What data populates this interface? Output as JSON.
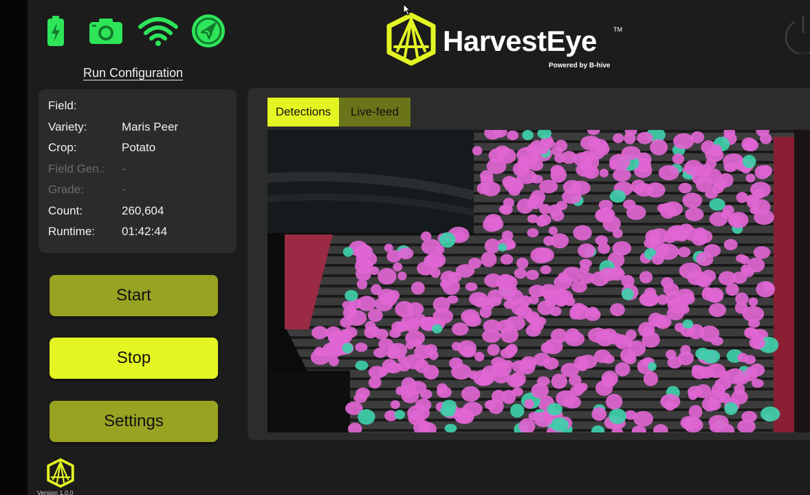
{
  "status_icons": [
    "battery-icon",
    "camera-icon",
    "wifi-icon",
    "navigation-icon"
  ],
  "run_config_link": "Run Configuration",
  "brand": {
    "name": "HarvestEye",
    "tm": "TM",
    "powered_by": "Powered by B-hive",
    "accent": "#e3f522"
  },
  "config": {
    "field_label": "Field:",
    "field_value": "",
    "variety_label": "Variety:",
    "variety_value": "Maris Peer",
    "crop_label": "Crop:",
    "crop_value": "Potato",
    "field_gen_label": "Field Gen.:",
    "field_gen_value": "-",
    "grade_label": "Grade:",
    "grade_value": "-",
    "count_label": "Count:",
    "count_value": "260,604",
    "runtime_label": "Runtime:",
    "runtime_value": "01:42:44"
  },
  "buttons": {
    "start": "Start",
    "stop": "Stop",
    "settings": "Settings"
  },
  "tabs": {
    "detections": "Detections",
    "live_feed": "Live-feed",
    "active": "detections"
  },
  "version": "Version 1.0.0",
  "colors": {
    "detection": "#e066d2",
    "untracked": "#3fcfaa",
    "button_dim": "#98a322",
    "button_active": "#e3f522"
  }
}
